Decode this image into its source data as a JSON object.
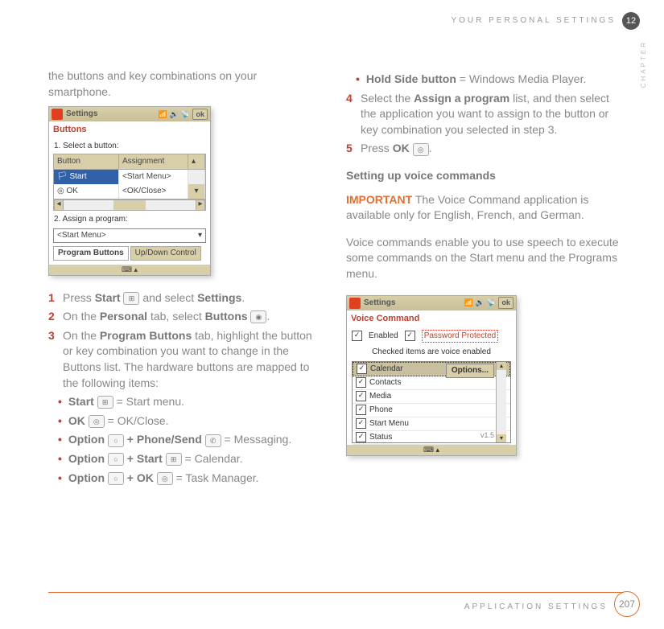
{
  "header": {
    "section": "YOUR PERSONAL SETTINGS",
    "chapter_num": "12",
    "chapter_label": "CHAPTER"
  },
  "left": {
    "intro": "the buttons and key combinations on your smartphone.",
    "shot1": {
      "title": "Settings",
      "ok": "ok",
      "section": "Buttons",
      "label1": "1. Select a button:",
      "hdr_button": "Button",
      "hdr_assign": "Assignment",
      "row_start_btn": "Start",
      "row_start_assign": "<Start Menu>",
      "row_ok_btn": "OK",
      "row_ok_assign": "<OK/Close>",
      "label2": "2. Assign a program:",
      "dropdown": "<Start Menu>",
      "tab1": "Program Buttons",
      "tab2": "Up/Down Control"
    },
    "step1_pre": "Press ",
    "step1_b1": "Start",
    "step1_mid": " and select ",
    "step1_b2": "Settings",
    "step1_end": ".",
    "step2_pre": "On the ",
    "step2_b1": "Personal",
    "step2_mid": " tab, select ",
    "step2_b2": "Buttons",
    "step2_end": ".",
    "step3_pre": "On the ",
    "step3_b1": "Program Buttons",
    "step3_rest": " tab, highlight the button or key combination you want to change in the Buttons list. The hardware buttons are mapped to the following items:",
    "b_start_b": "Start",
    "b_start_t": " = Start menu.",
    "b_ok_b": "OK",
    "b_ok_t": " = OK/Close.",
    "b_opt1_b1": "Option",
    "b_opt1_b2": " + Phone/Send",
    "b_opt1_t": " = Messaging.",
    "b_opt2_b1": "Option",
    "b_opt2_b2": " + Start",
    "b_opt2_t": " = Calendar.",
    "b_opt3_b1": "Option",
    "b_opt3_b2": " + OK",
    "b_opt3_t": " = Task Manager."
  },
  "right": {
    "b_hold_b": "Hold Side button",
    "b_hold_t": " = Windows Media Player.",
    "step4_pre": "Select the ",
    "step4_b1": "Assign a program",
    "step4_rest": " list, and then select the application you want to assign to the button or key combination you selected in step 3.",
    "step5_pre": "Press ",
    "step5_b1": "OK",
    "step5_end": ".",
    "section_title": "Setting up voice commands",
    "important": "IMPORTANT",
    "important_text": " The Voice Command application is available only for English, French, and German.",
    "para": "Voice commands enable you to use speech to execute some commands on the Start menu and the Programs menu.",
    "shot2": {
      "title": "Settings",
      "ok": "ok",
      "section": "Voice Command",
      "enabled": "Enabled",
      "pwd": "Password Protected",
      "subtitle": "Checked items are voice enabled",
      "options": "Options...",
      "items": [
        "Calendar",
        "Contacts",
        "Media",
        "Phone",
        "Start Menu",
        "Status"
      ],
      "version": "v1.5"
    }
  },
  "footer": {
    "text": "APPLICATION SETTINGS",
    "page": "207"
  },
  "nums": {
    "s1": "1",
    "s2": "2",
    "s3": "3",
    "s4": "4",
    "s5": "5"
  }
}
